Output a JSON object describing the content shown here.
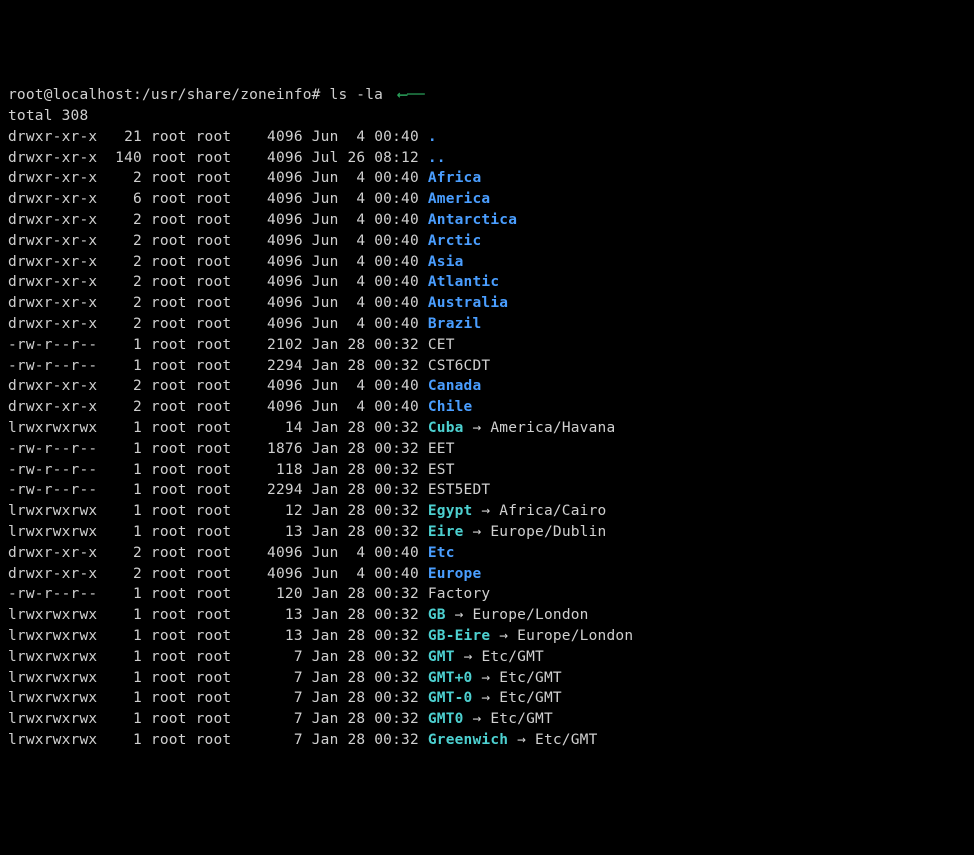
{
  "prompt": {
    "user_host": "root@localhost",
    "cwd": "/usr/share/zoneinfo",
    "sep": ":",
    "hash": "#",
    "command": "ls -la"
  },
  "arrow_glyph": "⟵",
  "total_line": "total 308",
  "symlink_arrow": "→",
  "entries": [
    {
      "perm": "drwxr-xr-x",
      "links": "21",
      "owner": "root",
      "group": "root",
      "size": "4096",
      "date": "Jun  4 00:40",
      "name": ".",
      "type": "dir"
    },
    {
      "perm": "drwxr-xr-x",
      "links": "140",
      "owner": "root",
      "group": "root",
      "size": "4096",
      "date": "Jul 26 08:12",
      "name": "..",
      "type": "dir"
    },
    {
      "perm": "drwxr-xr-x",
      "links": "2",
      "owner": "root",
      "group": "root",
      "size": "4096",
      "date": "Jun  4 00:40",
      "name": "Africa",
      "type": "dir"
    },
    {
      "perm": "drwxr-xr-x",
      "links": "6",
      "owner": "root",
      "group": "root",
      "size": "4096",
      "date": "Jun  4 00:40",
      "name": "America",
      "type": "dir"
    },
    {
      "perm": "drwxr-xr-x",
      "links": "2",
      "owner": "root",
      "group": "root",
      "size": "4096",
      "date": "Jun  4 00:40",
      "name": "Antarctica",
      "type": "dir"
    },
    {
      "perm": "drwxr-xr-x",
      "links": "2",
      "owner": "root",
      "group": "root",
      "size": "4096",
      "date": "Jun  4 00:40",
      "name": "Arctic",
      "type": "dir"
    },
    {
      "perm": "drwxr-xr-x",
      "links": "2",
      "owner": "root",
      "group": "root",
      "size": "4096",
      "date": "Jun  4 00:40",
      "name": "Asia",
      "type": "dir"
    },
    {
      "perm": "drwxr-xr-x",
      "links": "2",
      "owner": "root",
      "group": "root",
      "size": "4096",
      "date": "Jun  4 00:40",
      "name": "Atlantic",
      "type": "dir"
    },
    {
      "perm": "drwxr-xr-x",
      "links": "2",
      "owner": "root",
      "group": "root",
      "size": "4096",
      "date": "Jun  4 00:40",
      "name": "Australia",
      "type": "dir"
    },
    {
      "perm": "drwxr-xr-x",
      "links": "2",
      "owner": "root",
      "group": "root",
      "size": "4096",
      "date": "Jun  4 00:40",
      "name": "Brazil",
      "type": "dir"
    },
    {
      "perm": "-rw-r--r--",
      "links": "1",
      "owner": "root",
      "group": "root",
      "size": "2102",
      "date": "Jan 28 00:32",
      "name": "CET",
      "type": "file"
    },
    {
      "perm": "-rw-r--r--",
      "links": "1",
      "owner": "root",
      "group": "root",
      "size": "2294",
      "date": "Jan 28 00:32",
      "name": "CST6CDT",
      "type": "file"
    },
    {
      "perm": "drwxr-xr-x",
      "links": "2",
      "owner": "root",
      "group": "root",
      "size": "4096",
      "date": "Jun  4 00:40",
      "name": "Canada",
      "type": "dir"
    },
    {
      "perm": "drwxr-xr-x",
      "links": "2",
      "owner": "root",
      "group": "root",
      "size": "4096",
      "date": "Jun  4 00:40",
      "name": "Chile",
      "type": "dir"
    },
    {
      "perm": "lrwxrwxrwx",
      "links": "1",
      "owner": "root",
      "group": "root",
      "size": "14",
      "date": "Jan 28 00:32",
      "name": "Cuba",
      "type": "link",
      "target": "America/Havana"
    },
    {
      "perm": "-rw-r--r--",
      "links": "1",
      "owner": "root",
      "group": "root",
      "size": "1876",
      "date": "Jan 28 00:32",
      "name": "EET",
      "type": "file"
    },
    {
      "perm": "-rw-r--r--",
      "links": "1",
      "owner": "root",
      "group": "root",
      "size": "118",
      "date": "Jan 28 00:32",
      "name": "EST",
      "type": "file"
    },
    {
      "perm": "-rw-r--r--",
      "links": "1",
      "owner": "root",
      "group": "root",
      "size": "2294",
      "date": "Jan 28 00:32",
      "name": "EST5EDT",
      "type": "file"
    },
    {
      "perm": "lrwxrwxrwx",
      "links": "1",
      "owner": "root",
      "group": "root",
      "size": "12",
      "date": "Jan 28 00:32",
      "name": "Egypt",
      "type": "link",
      "target": "Africa/Cairo"
    },
    {
      "perm": "lrwxrwxrwx",
      "links": "1",
      "owner": "root",
      "group": "root",
      "size": "13",
      "date": "Jan 28 00:32",
      "name": "Eire",
      "type": "link",
      "target": "Europe/Dublin"
    },
    {
      "perm": "drwxr-xr-x",
      "links": "2",
      "owner": "root",
      "group": "root",
      "size": "4096",
      "date": "Jun  4 00:40",
      "name": "Etc",
      "type": "dir"
    },
    {
      "perm": "drwxr-xr-x",
      "links": "2",
      "owner": "root",
      "group": "root",
      "size": "4096",
      "date": "Jun  4 00:40",
      "name": "Europe",
      "type": "dir"
    },
    {
      "perm": "-rw-r--r--",
      "links": "1",
      "owner": "root",
      "group": "root",
      "size": "120",
      "date": "Jan 28 00:32",
      "name": "Factory",
      "type": "file"
    },
    {
      "perm": "lrwxrwxrwx",
      "links": "1",
      "owner": "root",
      "group": "root",
      "size": "13",
      "date": "Jan 28 00:32",
      "name": "GB",
      "type": "link",
      "target": "Europe/London"
    },
    {
      "perm": "lrwxrwxrwx",
      "links": "1",
      "owner": "root",
      "group": "root",
      "size": "13",
      "date": "Jan 28 00:32",
      "name": "GB-Eire",
      "type": "link",
      "target": "Europe/London"
    },
    {
      "perm": "lrwxrwxrwx",
      "links": "1",
      "owner": "root",
      "group": "root",
      "size": "7",
      "date": "Jan 28 00:32",
      "name": "GMT",
      "type": "link",
      "target": "Etc/GMT"
    },
    {
      "perm": "lrwxrwxrwx",
      "links": "1",
      "owner": "root",
      "group": "root",
      "size": "7",
      "date": "Jan 28 00:32",
      "name": "GMT+0",
      "type": "link",
      "target": "Etc/GMT"
    },
    {
      "perm": "lrwxrwxrwx",
      "links": "1",
      "owner": "root",
      "group": "root",
      "size": "7",
      "date": "Jan 28 00:32",
      "name": "GMT-0",
      "type": "link",
      "target": "Etc/GMT"
    },
    {
      "perm": "lrwxrwxrwx",
      "links": "1",
      "owner": "root",
      "group": "root",
      "size": "7",
      "date": "Jan 28 00:32",
      "name": "GMT0",
      "type": "link",
      "target": "Etc/GMT"
    },
    {
      "perm": "lrwxrwxrwx",
      "links": "1",
      "owner": "root",
      "group": "root",
      "size": "7",
      "date": "Jan 28 00:32",
      "name": "Greenwich",
      "type": "link",
      "target": "Etc/GMT"
    }
  ]
}
